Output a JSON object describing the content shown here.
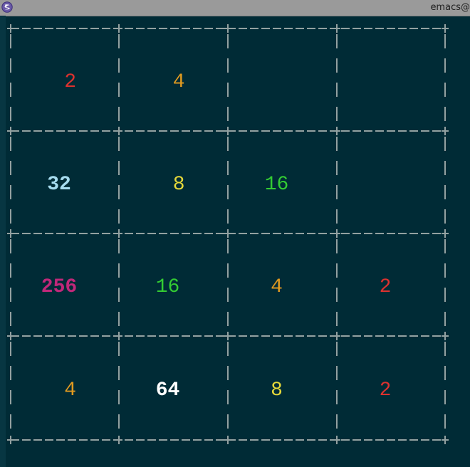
{
  "window": {
    "title": "emacs@"
  },
  "colors": {
    "background": "#002b36",
    "grid": "#93a1a1",
    "tile_2": "#dc322f",
    "tile_4": "#e09a20",
    "tile_8": "#e6d93a",
    "tile_16": "#33cc33",
    "tile_32": "#a6dcef",
    "tile_64": "#ffffff",
    "tile_256": "#c0287a"
  },
  "board": {
    "rows": 4,
    "cols": 4,
    "cells": [
      [
        "2",
        "4",
        "",
        ""
      ],
      [
        "32",
        "8",
        "16",
        ""
      ],
      [
        "256",
        "16",
        "4",
        "2"
      ],
      [
        "4",
        "64",
        "8",
        "2"
      ]
    ],
    "align": [
      [
        "right",
        "right",
        "center",
        "center"
      ],
      [
        "center",
        "right",
        "center",
        "center"
      ],
      [
        "center",
        "center",
        "center",
        "center"
      ],
      [
        "right",
        "center",
        "center",
        "center"
      ]
    ]
  }
}
